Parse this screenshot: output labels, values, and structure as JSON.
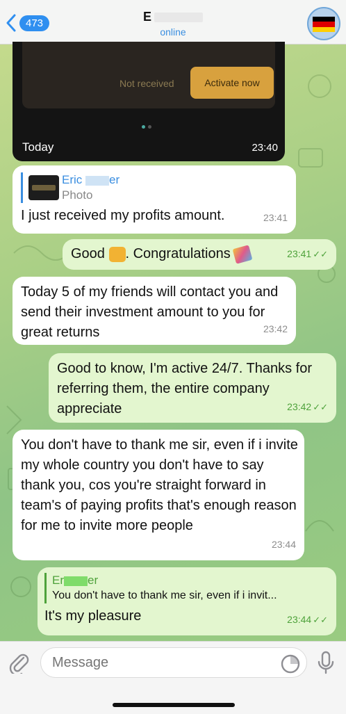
{
  "header": {
    "back_count": "473",
    "title": "E",
    "status": "online",
    "avatar_flag_colors": [
      "#000000",
      "#dd0000",
      "#ffce00"
    ]
  },
  "image_message": {
    "not_received": "Not received",
    "activate_now": "Activate now",
    "caption": "Today",
    "time": "23:40"
  },
  "messages": [
    {
      "direction": "in",
      "reply": {
        "name": "Eric",
        "name_tail": "er",
        "sub": "Photo"
      },
      "text": "I just received my profits amount.",
      "time": "23:41"
    },
    {
      "direction": "out",
      "text_a": "Good",
      "text_b": ". Congratulations",
      "time": "23:41"
    },
    {
      "direction": "in",
      "text": "Today 5 of my friends will contact you and send their investment amount to you for great returns",
      "time": "23:42"
    },
    {
      "direction": "out",
      "text": "Good to know, I'm active 24/7. Thanks for referring them, the entire company appreciate",
      "time": "23:42"
    },
    {
      "direction": "in",
      "text": "You don't have to thank me sir, even if i invite my whole country you don't have to say thank you, cos you're straight forward in team's of paying profits that's enough reason for me to invite more people",
      "time": "23:44"
    },
    {
      "direction": "out",
      "reply": {
        "name": "Er",
        "name_tail": "er",
        "sub": "You don't have to thank me sir, even if i invit..."
      },
      "text": "It's my pleasure",
      "time": "23:44"
    }
  ],
  "input": {
    "placeholder": "Message"
  },
  "colors": {
    "accent": "#3a8ee0",
    "outgoing_bubble": "#e3f6cf",
    "incoming_bubble": "#ffffff",
    "read_check": "#4ea23b"
  }
}
